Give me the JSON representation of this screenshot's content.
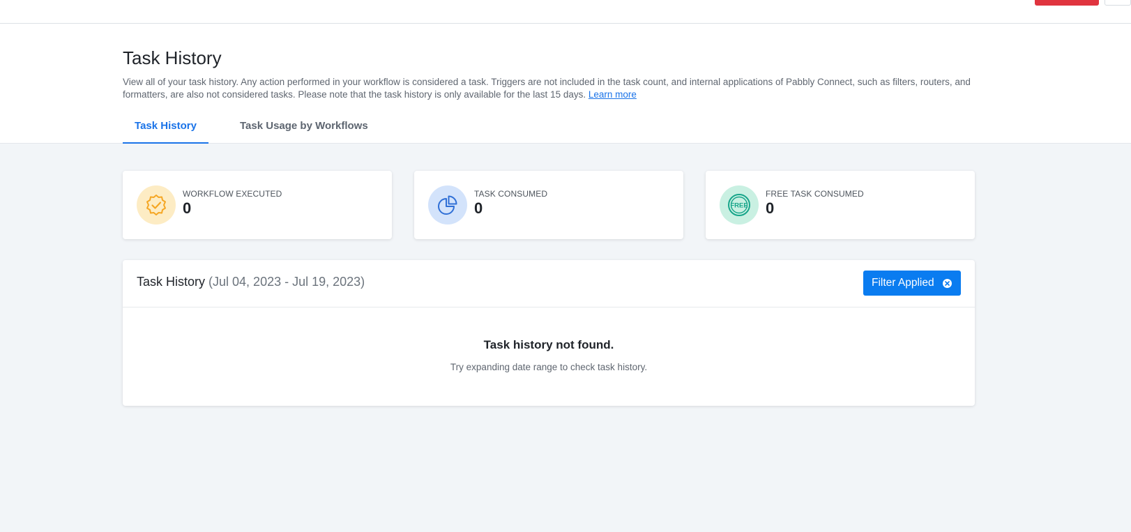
{
  "header": {
    "title": "Task History",
    "description": "View all of your task history. Any action performed in your workflow is considered a task. Triggers are not included in the task count, and internal applications of Pabbly Connect, such as filters, routers, and formatters, are also not considered tasks. Please note that the task history is only available for the last 15 days.",
    "learn_more": "Learn more"
  },
  "tabs": [
    {
      "label": "Task History",
      "active": true
    },
    {
      "label": "Task Usage by Workflows",
      "active": false
    }
  ],
  "stats": [
    {
      "label": "WORKFLOW EXECUTED",
      "value": "0",
      "icon": "verified-badge-icon",
      "color": "#f5a623"
    },
    {
      "label": "TASK CONSUMED",
      "value": "0",
      "icon": "pie-chart-icon",
      "color": "#2f6fd6"
    },
    {
      "label": "FREE TASK CONSUMED",
      "value": "0",
      "icon": "free-badge-icon",
      "color": "#17a58a"
    }
  ],
  "panel": {
    "title": "Task History",
    "date_range": "(Jul 04, 2023 - Jul 19, 2023)",
    "filter_label": "Filter Applied",
    "empty_title": "Task history not found.",
    "empty_subtitle": "Try expanding date range to check task history."
  },
  "colors": {
    "accent": "#1a73e8",
    "button": "#0a7cf0",
    "top_action": "#e0343f",
    "background": "#f2f5f8"
  }
}
